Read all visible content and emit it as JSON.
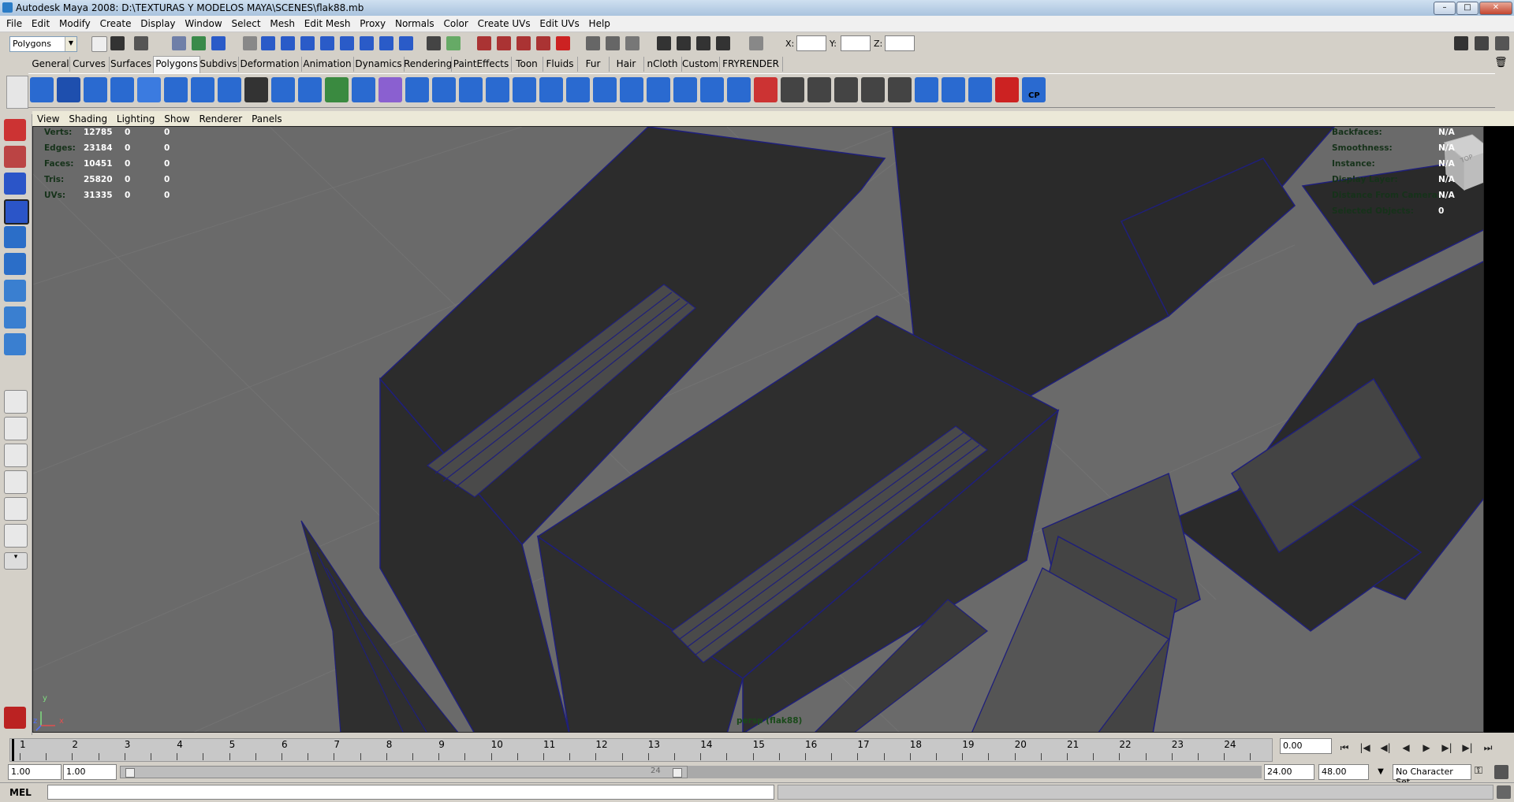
{
  "window": {
    "title": "Autodesk Maya 2008: D:\\TEXTURAS Y MODELOS MAYA\\SCENES\\flak88.mb",
    "minimize": "–",
    "maximize": "□",
    "close": "✕"
  },
  "menu": [
    "File",
    "Edit",
    "Modify",
    "Create",
    "Display",
    "Window",
    "Select",
    "Mesh",
    "Edit Mesh",
    "Proxy",
    "Normals",
    "Color",
    "Create UVs",
    "Edit UVs",
    "Help"
  ],
  "statusline": {
    "menu_set": "Polygons",
    "x_label": "X:",
    "y_label": "Y:",
    "z_label": "Z:",
    "x_value": "",
    "y_value": "",
    "z_value": ""
  },
  "shelf_tabs": [
    "General",
    "Curves",
    "Surfaces",
    "Polygons",
    "Subdivs",
    "Deformation",
    "Animation",
    "Dynamics",
    "Rendering",
    "PaintEffects",
    "Toon",
    "Fluids",
    "Fur",
    "Hair",
    "nCloth",
    "Custom",
    "FRYRENDER"
  ],
  "active_shelf_tab": "Polygons",
  "shelf_last_label": "CP",
  "panel_menu": [
    "View",
    "Shading",
    "Lighting",
    "Show",
    "Renderer",
    "Panels"
  ],
  "hud_stats": [
    {
      "label": "Verts:",
      "v1": "12785",
      "v2": "0",
      "v3": "0"
    },
    {
      "label": "Edges:",
      "v1": "23184",
      "v2": "0",
      "v3": "0"
    },
    {
      "label": "Faces:",
      "v1": "10451",
      "v2": "0",
      "v3": "0"
    },
    {
      "label": "Tris:",
      "v1": "25820",
      "v2": "0",
      "v3": "0"
    },
    {
      "label": "UVs:",
      "v1": "31335",
      "v2": "0",
      "v3": "0"
    }
  ],
  "hud_right": [
    {
      "label": "Backfaces:",
      "value": "N/A"
    },
    {
      "label": "Smoothness:",
      "value": "N/A"
    },
    {
      "label": "Instance:",
      "value": "N/A"
    },
    {
      "label": "Display Layer:",
      "value": "N/A"
    },
    {
      "label": "Distance From Camera:",
      "value": "N/A"
    },
    {
      "label": "Selected Objects:",
      "value": "0"
    }
  ],
  "viewcube_label": "TOP",
  "camera_label": "persp (flak88)",
  "axis": {
    "y": "y",
    "x": "x",
    "z": "z"
  },
  "timeline": {
    "ticks": [
      "1",
      "2",
      "3",
      "4",
      "5",
      "6",
      "7",
      "8",
      "9",
      "10",
      "11",
      "12",
      "13",
      "14",
      "15",
      "16",
      "17",
      "18",
      "19",
      "20",
      "21",
      "22",
      "23",
      "24"
    ],
    "current_time": "0.00"
  },
  "range": {
    "start": "1.00",
    "start_inner": "1.00",
    "end_inner": "24.00",
    "end": "48.00",
    "slider_end_label": "24",
    "character_set": "No Character Set"
  },
  "playback": [
    "⏮",
    "|◀",
    "◀|",
    "◀",
    "▶",
    "▶|",
    "▶|",
    "⏭"
  ],
  "cmd": {
    "label": "MEL"
  },
  "colors": {
    "viewport_bg": "#6a6a6a",
    "mesh_fill": "#2a2a2a",
    "wire": "#1f1f7a",
    "hud_label": "#16321a"
  }
}
